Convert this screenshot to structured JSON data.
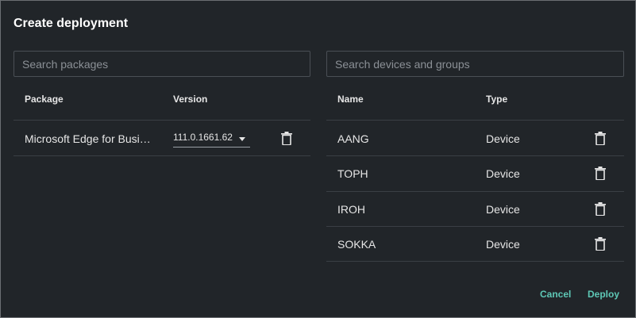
{
  "dialog": {
    "title": "Create deployment"
  },
  "packages": {
    "search_placeholder": "Search packages",
    "headers": {
      "package": "Package",
      "version": "Version"
    },
    "rows": [
      {
        "name": "Microsoft Edge for Business",
        "version": "111.0.1661.62"
      }
    ]
  },
  "devices": {
    "search_placeholder": "Search devices and groups",
    "headers": {
      "name": "Name",
      "type": "Type"
    },
    "rows": [
      {
        "name": "AANG",
        "type": "Device"
      },
      {
        "name": "TOPH",
        "type": "Device"
      },
      {
        "name": "IROH",
        "type": "Device"
      },
      {
        "name": "SOKKA",
        "type": "Device"
      }
    ]
  },
  "actions": {
    "cancel_label": "Cancel",
    "deploy_label": "Deploy"
  },
  "icons": {
    "delete": "trash-icon",
    "dropdown": "chevron-down-icon"
  },
  "colors": {
    "background": "#212529",
    "accent": "#5ec8b6",
    "text": "#e6e6e6"
  }
}
